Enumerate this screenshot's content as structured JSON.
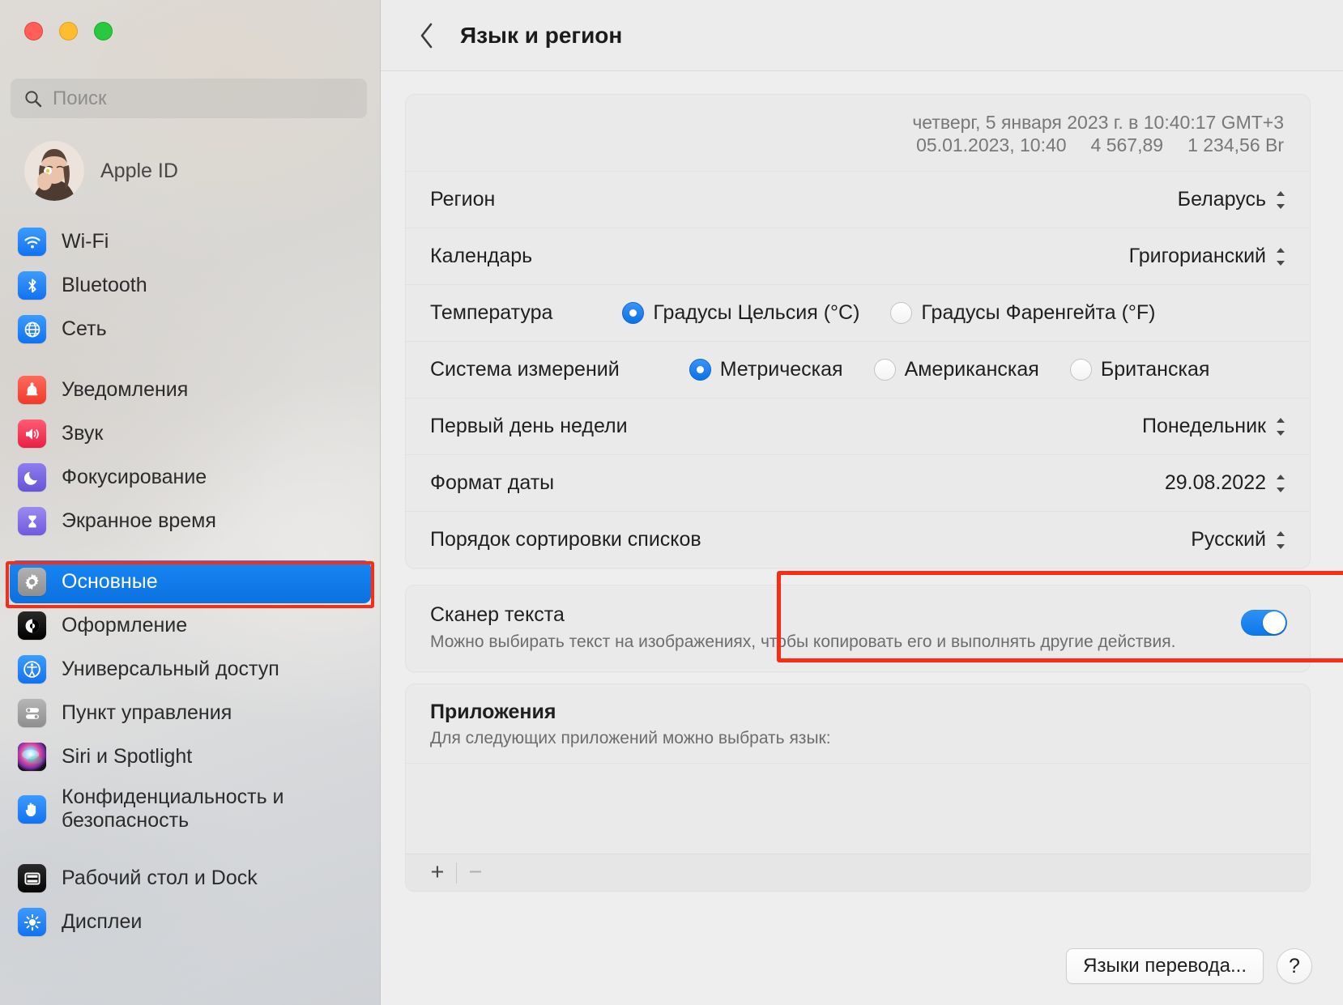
{
  "window": {
    "traffic_lights": [
      "close",
      "minimize",
      "zoom"
    ]
  },
  "sidebar": {
    "search": {
      "placeholder": "Поиск",
      "value": ""
    },
    "account": {
      "label": "Apple ID"
    },
    "groups": [
      {
        "items": [
          {
            "label": "Wi-Fi",
            "icon": "wifi-icon"
          },
          {
            "label": "Bluetooth",
            "icon": "bluetooth-icon"
          },
          {
            "label": "Сеть",
            "icon": "network-globe-icon"
          }
        ]
      },
      {
        "items": [
          {
            "label": "Уведомления",
            "icon": "bell-icon"
          },
          {
            "label": "Звук",
            "icon": "speaker-icon"
          },
          {
            "label": "Фокусирование",
            "icon": "moon-icon"
          },
          {
            "label": "Экранное время",
            "icon": "hourglass-icon"
          }
        ]
      },
      {
        "items": [
          {
            "label": "Основные",
            "icon": "gear-icon",
            "selected": true
          },
          {
            "label": "Оформление",
            "icon": "appearance-icon"
          },
          {
            "label": "Универсальный доступ",
            "icon": "accessibility-icon"
          },
          {
            "label": "Пункт управления",
            "icon": "control-center-icon"
          },
          {
            "label": "Siri и Spotlight",
            "icon": "siri-icon"
          },
          {
            "label": "Конфиденциальность и безопасность",
            "icon": "privacy-hand-icon"
          }
        ]
      },
      {
        "items": [
          {
            "label": "Рабочий стол и Dock",
            "icon": "desktop-dock-icon"
          },
          {
            "label": "Дисплеи",
            "icon": "display-brightness-icon"
          }
        ]
      }
    ]
  },
  "toolbar": {
    "back_icon": "chevron-left-icon",
    "title": "Язык и регион"
  },
  "preview": {
    "line1": "четверг, 5 января 2023 г. в 10:40:17 GMT+3",
    "line2_date": "05.01.2023, 10:40",
    "line2_number": "4 567,89",
    "line2_currency": "1 234,56 Br"
  },
  "settings": {
    "region": {
      "label": "Регион",
      "value": "Беларусь"
    },
    "calendar": {
      "label": "Календарь",
      "value": "Григорианский"
    },
    "temperature": {
      "label": "Температура",
      "options": [
        {
          "label": "Градусы Цельсия (°C)",
          "selected": true
        },
        {
          "label": "Градусы Фаренгейта (°F)",
          "selected": false
        }
      ]
    },
    "measurement": {
      "label": "Система измерений",
      "options": [
        {
          "label": "Метрическая",
          "selected": true
        },
        {
          "label": "Американская",
          "selected": false
        },
        {
          "label": "Британская",
          "selected": false
        }
      ]
    },
    "first_day": {
      "label": "Первый день недели",
      "value": "Понедельник"
    },
    "date_format": {
      "label": "Формат даты",
      "value": "29.08.2022"
    },
    "sort_order": {
      "label": "Порядок сортировки списков",
      "value": "Русский"
    }
  },
  "text_scanner": {
    "title": "Сканер текста",
    "description": "Можно выбирать текст на изображениях, чтобы копировать его и выполнять другие действия.",
    "enabled": true
  },
  "apps": {
    "title": "Приложения",
    "subtitle": "Для следующих приложений можно выбрать язык:",
    "items": [],
    "add_label": "+",
    "remove_label": "−"
  },
  "footer": {
    "translation_languages_label": "Языки перевода...",
    "help_label": "?"
  },
  "colors": {
    "accent": "#0b72e0",
    "highlight_box": "#fa2d14",
    "toggle_on": "#0c78ea"
  }
}
